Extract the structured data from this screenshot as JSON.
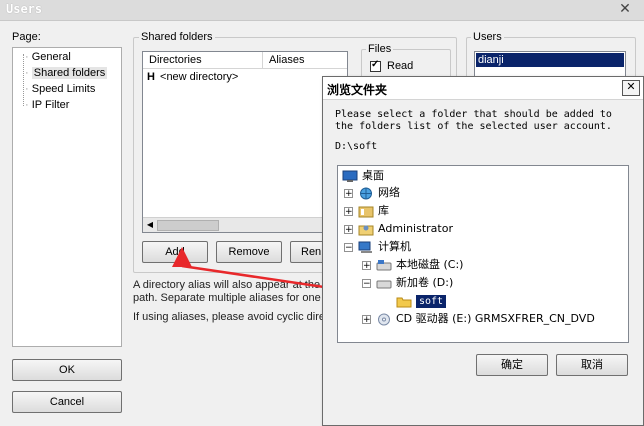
{
  "window": {
    "title": "Users",
    "close_glyph": "✕"
  },
  "page_panel": {
    "label": "Page:",
    "items": [
      "General",
      "Shared folders",
      "Speed Limits",
      "IP Filter"
    ],
    "selected_index": 1
  },
  "shared": {
    "group_label": "Shared folders",
    "col_directories": "Directories",
    "col_aliases": "Aliases",
    "row_marker": "H",
    "row_text": "<new directory>",
    "add_label": "Add",
    "remove_label": "Remove",
    "rename_label": "Ren",
    "info_line1": "A directory alias will also appear at the s",
    "info_line2": "path. Separate multiple aliases for one d",
    "info_line3": "If using aliases, please avoid cyclic direc"
  },
  "files": {
    "label": "Files",
    "read_label": "Read",
    "read_checked": true
  },
  "users": {
    "label": "Users",
    "items": [
      "dianji"
    ]
  },
  "buttons": {
    "ok_label": "OK",
    "cancel_label": "Cancel"
  },
  "dialog": {
    "title": "浏览文件夹",
    "close_glyph": "✕",
    "desc_line1": "Please select a folder that should be added to",
    "desc_line2": "the folders list of the selected user account.",
    "path": "D:\\soft",
    "tree": [
      {
        "label": "桌面",
        "icon": "desktop-icon",
        "expander": ""
      },
      {
        "label": "网络",
        "icon": "network-icon",
        "expander": "+"
      },
      {
        "label": "库",
        "icon": "library-icon",
        "expander": "+"
      },
      {
        "label": "Administrator",
        "icon": "user-icon",
        "expander": "+"
      },
      {
        "label": "计算机",
        "icon": "computer-icon",
        "expander": "−"
      },
      {
        "label": "本地磁盘 (C:)",
        "icon": "drive-icon",
        "expander": "+"
      },
      {
        "label": "新加卷 (D:)",
        "icon": "drive-icon",
        "expander": "−"
      },
      {
        "label": "soft",
        "icon": "folder-icon",
        "expander": ""
      },
      {
        "label": "CD 驱动器 (E:) GRMSXFRER_CN_DVD",
        "icon": "cd-icon",
        "expander": "+"
      }
    ],
    "ok_label": "确定",
    "cancel_label": "取消"
  },
  "colors": {
    "selection": "#0a246a",
    "arrow": "#e8282b"
  }
}
